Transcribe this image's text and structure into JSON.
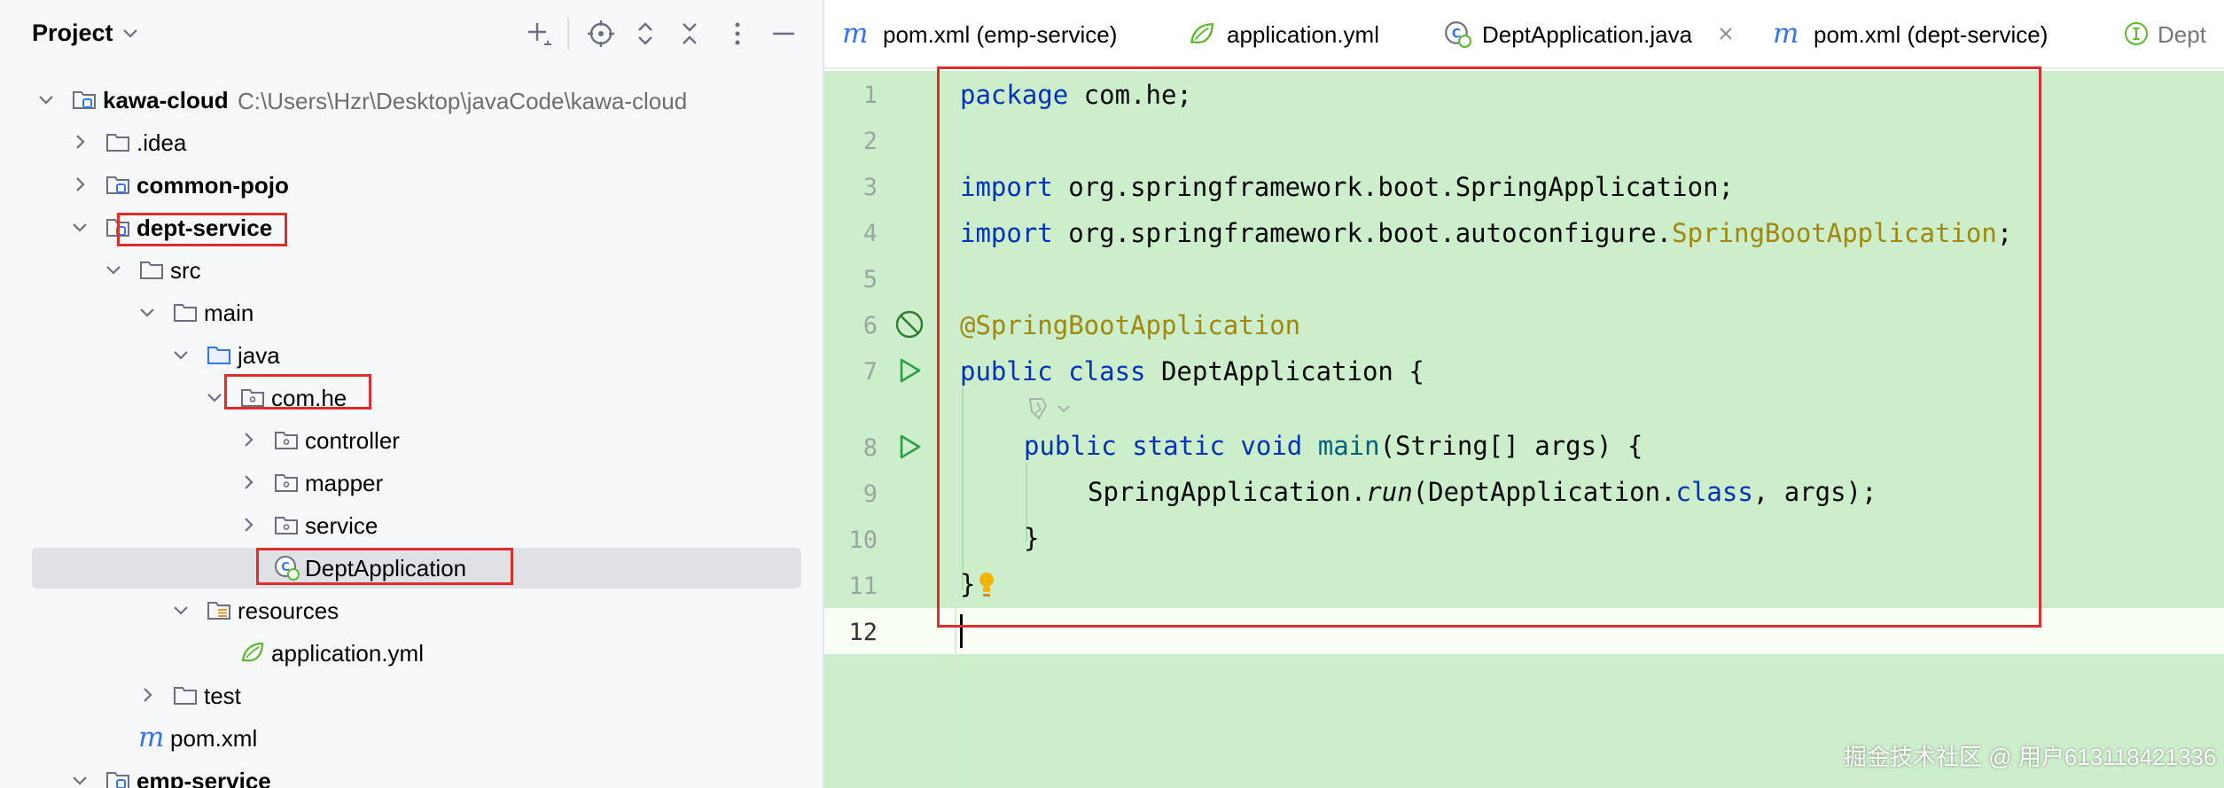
{
  "project_panel": {
    "title": "Project",
    "tree": [
      {
        "label": "kawa-cloud",
        "path": "C:\\Users\\Hzr\\Desktop\\javaCode\\kawa-cloud"
      },
      {
        "label": ".idea"
      },
      {
        "label": "common-pojo"
      },
      {
        "label": "dept-service"
      },
      {
        "label": "src"
      },
      {
        "label": "main"
      },
      {
        "label": "java"
      },
      {
        "label": "com.he"
      },
      {
        "label": "controller"
      },
      {
        "label": "mapper"
      },
      {
        "label": "service"
      },
      {
        "label": "DeptApplication"
      },
      {
        "label": "resources"
      },
      {
        "label": "application.yml"
      },
      {
        "label": "test"
      },
      {
        "label": "pom.xml"
      },
      {
        "label": "emp-service"
      }
    ]
  },
  "tabs": [
    {
      "label": "pom.xml (emp-service)",
      "icon": "maven-icon"
    },
    {
      "label": "application.yml",
      "icon": "spring-config-icon"
    },
    {
      "label": "DeptApplication.java",
      "icon": "spring-boot-class-icon",
      "active": true
    },
    {
      "label": "pom.xml (dept-service)",
      "icon": "maven-icon"
    },
    {
      "label": "Dept",
      "icon": "interface-icon"
    }
  ],
  "editor": {
    "line_numbers": [
      "1",
      "2",
      "3",
      "4",
      "5",
      "6",
      "7",
      "8",
      "9",
      "10",
      "11",
      "12"
    ],
    "code": {
      "l1_kw": "package",
      "l1_rest": " com.he;",
      "l3_kw": "import",
      "l3_rest": " org.springframework.boot.SpringApplication;",
      "l4_kw": "import",
      "l4_mid": " org.springframework.boot.autoconfigure.",
      "l4_ann": "SpringBootApplication",
      "l4_end": ";",
      "l6_ann": "@SpringBootApplication",
      "l7_kw": "public class",
      "l7_rest": " DeptApplication {",
      "l8_kw": "public static void",
      "l8_fn": " main",
      "l8_rest": "(String[] args) {",
      "l9_a": "SpringApplication.",
      "l9_it": "run",
      "l9_b": "(DeptApplication.",
      "l9_kw": "class",
      "l9_c": ", args);",
      "l10": "}",
      "l11": "}"
    }
  },
  "colors": {
    "editor_background": "#cdeecb",
    "keyword": "#0033b3",
    "annotation": "#9e880d",
    "accent": "#3574f0",
    "highlight_box": "#e12c2c"
  },
  "watermark": "掘金技术社区 @ 用户613118421336"
}
